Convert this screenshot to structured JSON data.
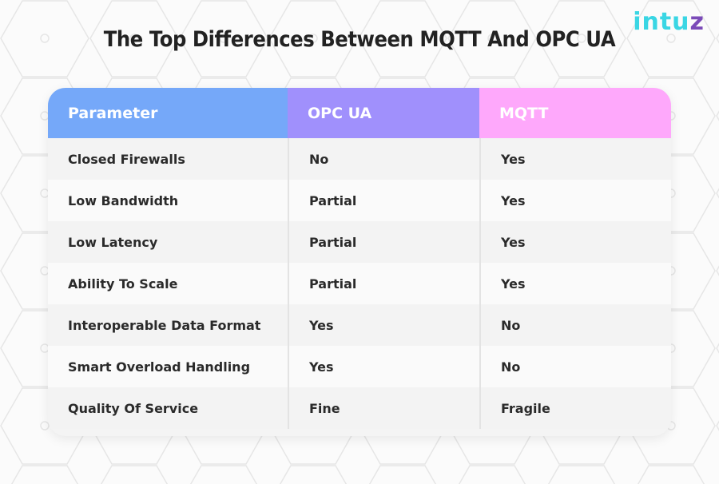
{
  "brand": {
    "logo_main": "intu",
    "logo_accent": "z"
  },
  "title": "The Top Differences Between MQTT And OPC UA",
  "colors": {
    "parameter_header": "#75a8f9",
    "opcua_header": "#a090fc",
    "mqtt_header": "#fea8fb",
    "logo": "#3ad6e4"
  },
  "table": {
    "headers": [
      "Parameter",
      "OPC UA",
      "MQTT"
    ],
    "rows": [
      {
        "parameter": "Closed Firewalls",
        "opcua": "No",
        "mqtt": "Yes"
      },
      {
        "parameter": "Low Bandwidth",
        "opcua": "Partial",
        "mqtt": "Yes"
      },
      {
        "parameter": "Low Latency",
        "opcua": "Partial",
        "mqtt": "Yes"
      },
      {
        "parameter": "Ability To Scale",
        "opcua": "Partial",
        "mqtt": "Yes"
      },
      {
        "parameter": "Interoperable Data Format",
        "opcua": "Yes",
        "mqtt": "No"
      },
      {
        "parameter": "Smart Overload Handling",
        "opcua": "Yes",
        "mqtt": "No"
      },
      {
        "parameter": "Quality Of Service",
        "opcua": "Fine",
        "mqtt": "Fragile"
      }
    ]
  }
}
